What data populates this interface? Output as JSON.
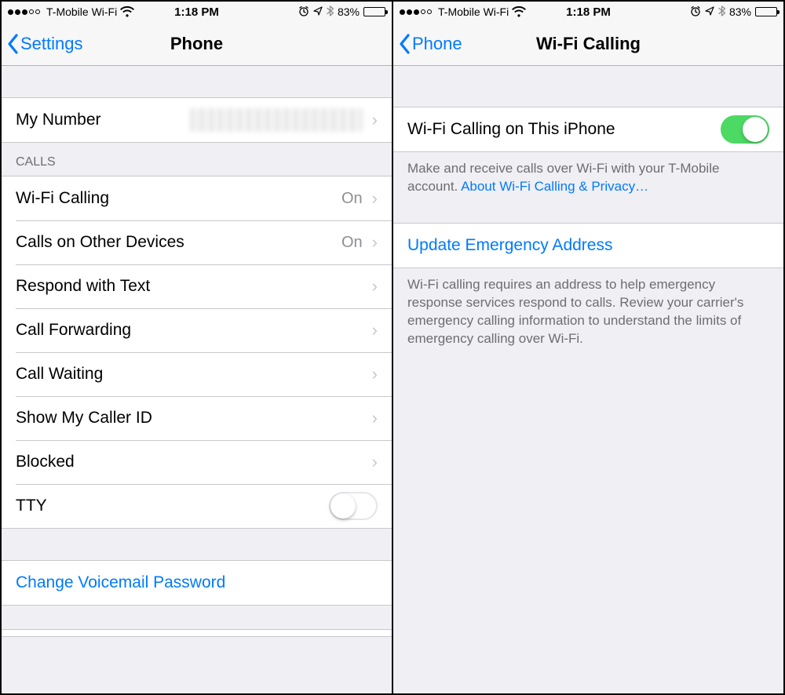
{
  "status": {
    "carrier": "T-Mobile Wi-Fi",
    "time": "1:18 PM",
    "battery": "83%"
  },
  "left": {
    "back": "Settings",
    "title": "Phone",
    "section1": {
      "my_number": "My Number"
    },
    "calls_header": "CALLS",
    "calls": {
      "wifi_calling": "Wi-Fi Calling",
      "wifi_calling_val": "On",
      "other_devices": "Calls on Other Devices",
      "other_devices_val": "On",
      "respond_text": "Respond with Text",
      "call_forwarding": "Call Forwarding",
      "call_waiting": "Call Waiting",
      "show_caller_id": "Show My Caller ID",
      "blocked": "Blocked",
      "tty": "TTY"
    },
    "voicemail": "Change Voicemail Password"
  },
  "right": {
    "back": "Phone",
    "title": "Wi-Fi Calling",
    "toggle_label": "Wi-Fi Calling on This iPhone",
    "toggle_on": true,
    "footer1_a": "Make and receive calls over Wi-Fi with your T-Mobile account. ",
    "footer1_link": "About Wi-Fi Calling & Privacy…",
    "update_address": "Update Emergency Address",
    "footer2": "Wi-Fi calling requires an address to help emergency response services respond to calls. Review your carrier's emergency calling information to understand the limits of emergency calling over Wi-Fi."
  }
}
